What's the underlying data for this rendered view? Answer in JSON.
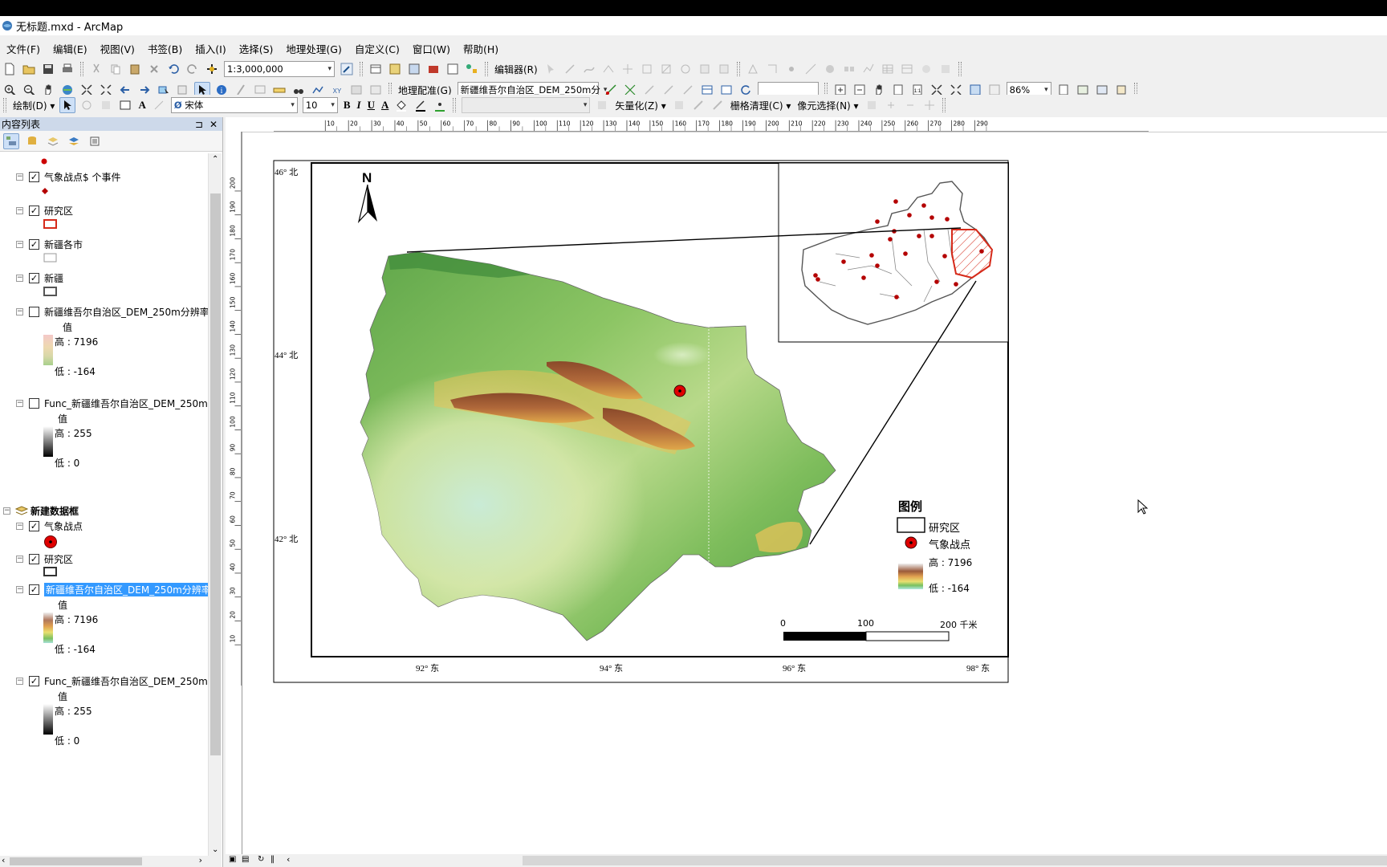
{
  "window": {
    "title": "无标题.mxd - ArcMap"
  },
  "menu": [
    "文件(F)",
    "编辑(E)",
    "视图(V)",
    "书签(B)",
    "插入(I)",
    "选择(S)",
    "地理处理(G)",
    "自定义(C)",
    "窗口(W)",
    "帮助(H)"
  ],
  "toolbar": {
    "scale": "1:3,000,000",
    "editor_label": "编辑器(R)",
    "georef_label": "地理配准(G)",
    "georef_layer": "新疆维吾尔自治区_DEM_250m分",
    "zoom": "86%",
    "draw_label": "绘制(D)",
    "font_name": "宋体",
    "font_size": "10",
    "bold": "B",
    "italic": "I",
    "underline": "U",
    "font_color": "A",
    "text_tool": "A",
    "vectorize_label": "矢量化(Z)",
    "raster_cleanup_label": "栅格清理(C)",
    "cell_select_label": "像元选择(N)"
  },
  "toc": {
    "title": "内容列表",
    "pin": "ᵖ",
    "close": "✕",
    "layers_top": [
      {
        "name": "气象战点$ 个事件"
      },
      {
        "name": "研究区"
      },
      {
        "name": "新疆各市"
      },
      {
        "name": "新疆"
      },
      {
        "name": "新疆维吾尔自治区_DEM_250m分辨率_",
        "value_label": "值",
        "high": "高 : 7196",
        "low": "低 : -164"
      },
      {
        "name": "Func_新疆维吾尔自治区_DEM_250m分",
        "value_label": "值",
        "high": "高 : 255",
        "low": "低 : 0"
      }
    ],
    "frame_name": "新建数据框",
    "layers_frame": [
      {
        "name": "气象战点"
      },
      {
        "name": "研究区"
      },
      {
        "name": "新疆维吾尔自治区_DEM_250m分辨率_",
        "value_label": "值",
        "high": "高 : 7196",
        "low": "低 : -164"
      },
      {
        "name": "Func_新疆维吾尔自治区_DEM_250m分",
        "value_label": "值",
        "high": "高 : 255",
        "low": "低 : 0"
      }
    ]
  },
  "map": {
    "north": "N",
    "lat_labels": [
      "46° 北",
      "44° 北",
      "42° 北"
    ],
    "lon_labels": [
      "92° 东",
      "94° 东",
      "96° 东",
      "98° 东"
    ],
    "legend_title": "图例",
    "legend_items": [
      "研究区",
      "气象战点"
    ],
    "legend_high": "高 : 7196",
    "legend_low": "低 : -164",
    "scalebar": {
      "l0": "0",
      "l1": "100",
      "l2": "200 千米"
    }
  },
  "ruler": {
    "h": [
      "10",
      "20",
      "30",
      "40",
      "50",
      "60",
      "70",
      "80",
      "90",
      "100",
      "110",
      "120",
      "130",
      "140",
      "150",
      "160",
      "170",
      "180",
      "190",
      "200",
      "210",
      "220",
      "230",
      "240",
      "250",
      "260",
      "270",
      "280",
      "290"
    ],
    "v": [
      "200",
      "190",
      "180",
      "170",
      "160",
      "150",
      "140",
      "130",
      "120",
      "110",
      "100",
      "90",
      "80",
      "70",
      "60",
      "50",
      "40",
      "30",
      "20",
      "10"
    ]
  },
  "colors": {
    "selection": "#3399ff",
    "toc_header": "#cdd9ea",
    "station_red": "#d40000",
    "study_area_red": "#d62a1a"
  }
}
